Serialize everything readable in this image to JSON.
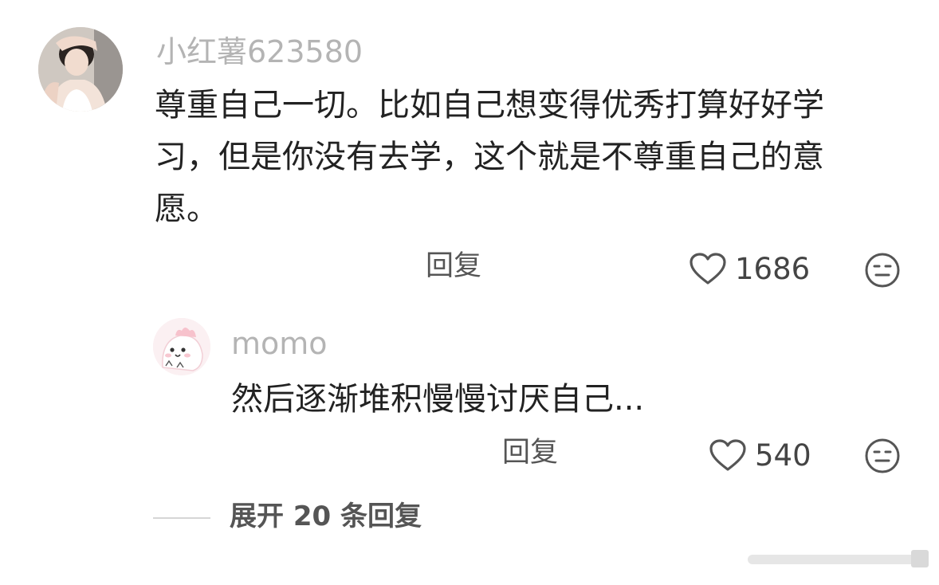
{
  "comment": {
    "username": "小红薯623580",
    "lines": [
      "尊重自己一切。比如自己想变得优秀打算好好学",
      "习，但是你没有去学，这个就是不尊重自己的意",
      "愿。"
    ],
    "reply_label": "回复",
    "like_count": "1686"
  },
  "reply": {
    "username": "momo",
    "text": "然后逐渐堆积慢慢讨厌自己...",
    "reply_label": "回复",
    "like_count": "540"
  },
  "expand_label": "展开 20 条回复",
  "icons": {
    "like": "heart-outline-icon",
    "emoji": "neutral-face-icon"
  },
  "colors": {
    "username": "#b4b4b4",
    "text": "#222222",
    "secondary": "#555555"
  }
}
